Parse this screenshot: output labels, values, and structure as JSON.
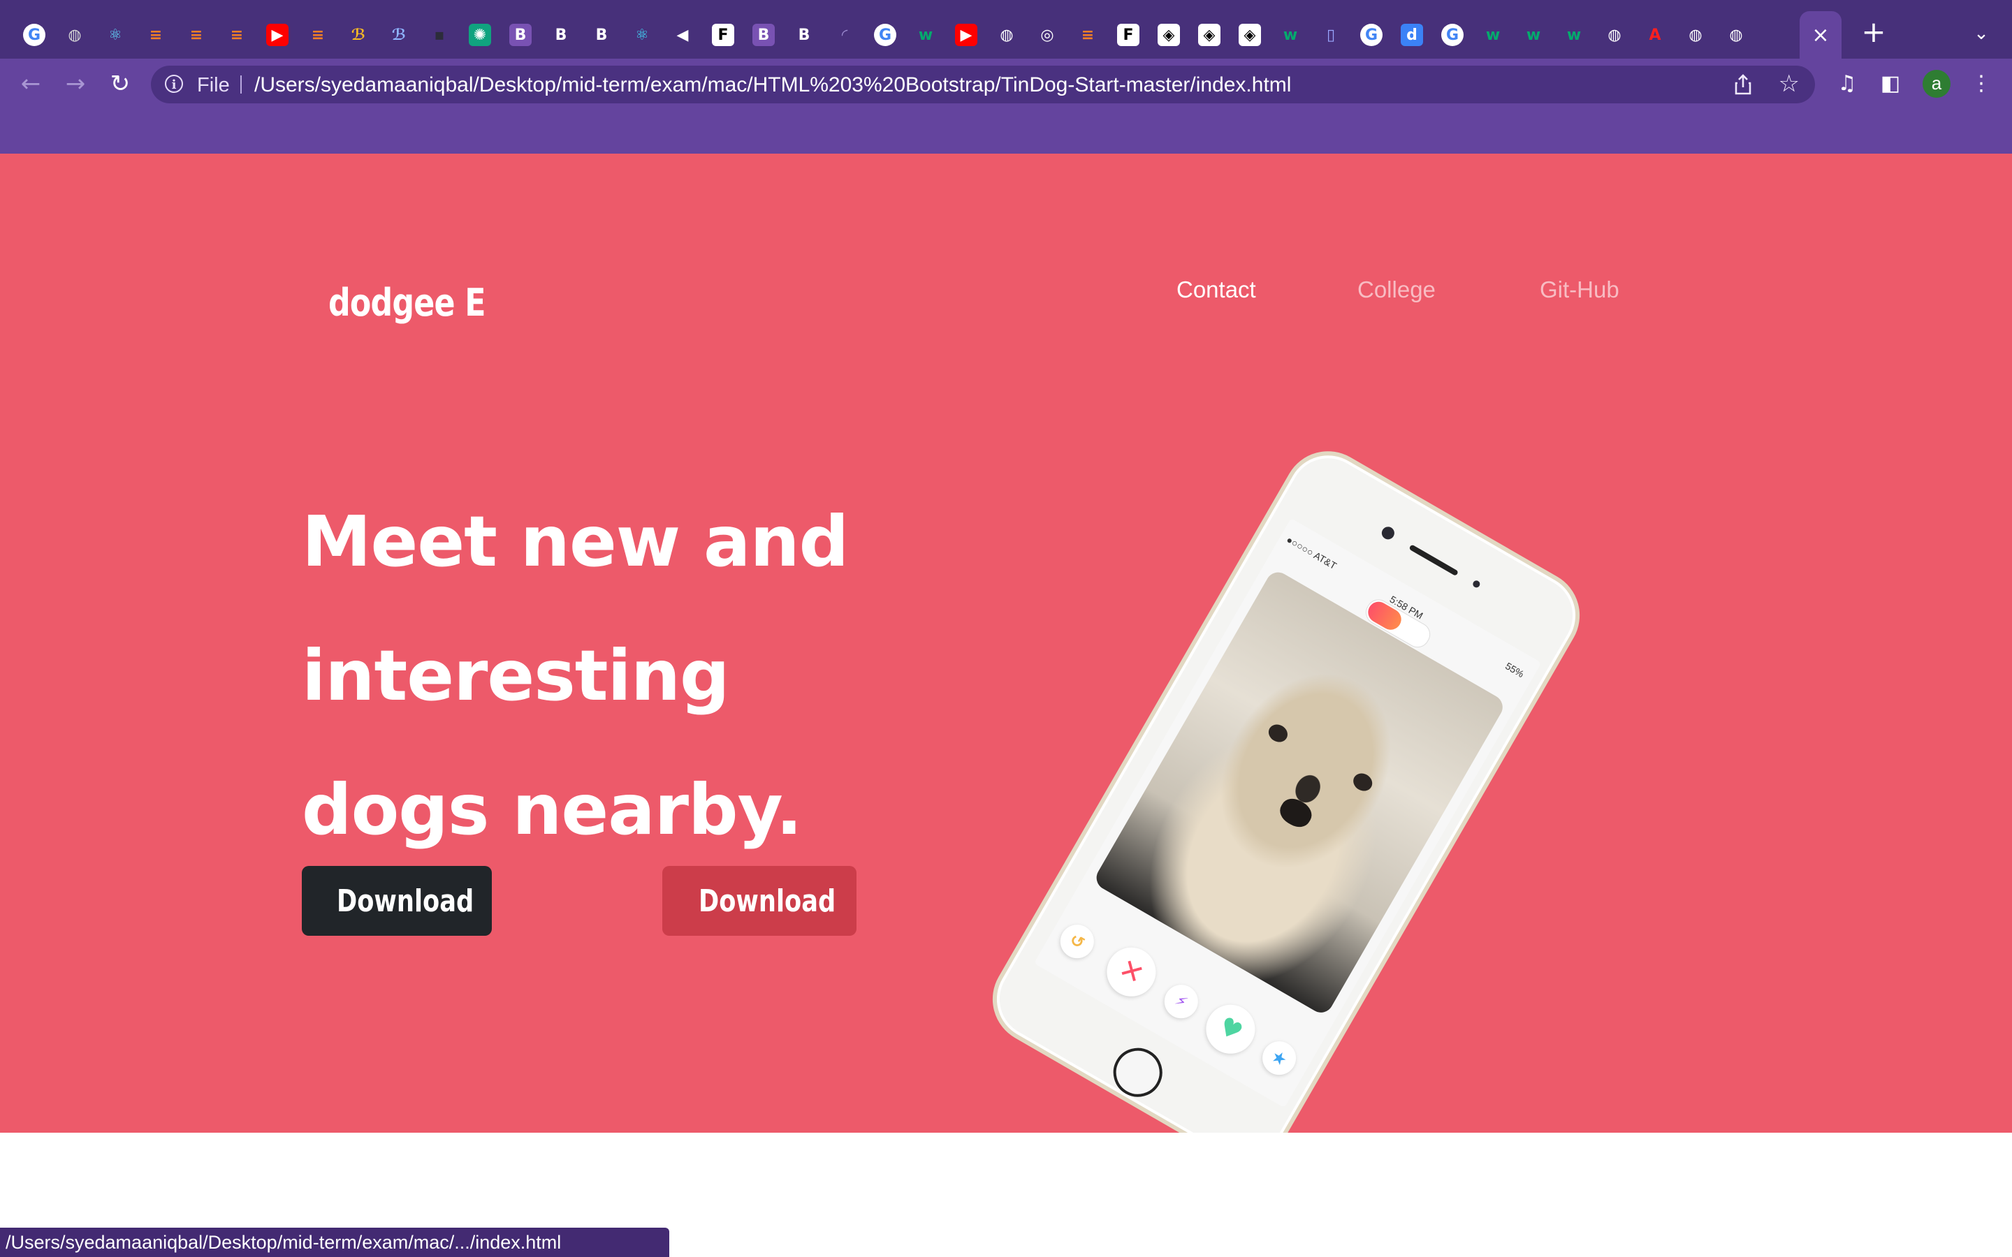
{
  "browser": {
    "tabs": [
      {
        "icon": "google-icon",
        "glyph": "G",
        "bg": "#ffffff",
        "fg": "#4285f4",
        "round": true
      },
      {
        "icon": "globe-icon",
        "glyph": "◍",
        "bg": "transparent",
        "fg": "#d7d7d7",
        "round": true
      },
      {
        "icon": "react-icon",
        "glyph": "⚛",
        "bg": "transparent",
        "fg": "#61dafb",
        "round": true
      },
      {
        "icon": "stackoverflow-icon",
        "glyph": "≡",
        "bg": "transparent",
        "fg": "#f48024",
        "round": false
      },
      {
        "icon": "stackoverflow-icon",
        "glyph": "≡",
        "bg": "transparent",
        "fg": "#f48024",
        "round": false
      },
      {
        "icon": "stackoverflow-icon",
        "glyph": "≡",
        "bg": "transparent",
        "fg": "#f48024",
        "round": false
      },
      {
        "icon": "youtube-icon",
        "glyph": "▶",
        "bg": "#ff0000",
        "fg": "#ffffff",
        "round": false
      },
      {
        "icon": "stackoverflow-icon",
        "glyph": "≡",
        "bg": "transparent",
        "fg": "#f48024",
        "round": false
      },
      {
        "icon": "figma-plugin-icon",
        "glyph": "ℬ",
        "bg": "transparent",
        "fg": "#f7b924",
        "round": false
      },
      {
        "icon": "figma-plugin-icon",
        "glyph": "ℬ",
        "bg": "transparent",
        "fg": "#8fb5ff",
        "round": false
      },
      {
        "icon": "dark-app-icon",
        "glyph": "▪",
        "bg": "transparent",
        "fg": "#2c2c3a",
        "round": false
      },
      {
        "icon": "chatgpt-icon",
        "glyph": "✺",
        "bg": "#10a37f",
        "fg": "#ffffff",
        "round": false
      },
      {
        "icon": "bootstrap-icon",
        "glyph": "B",
        "bg": "#7952b3",
        "fg": "#ffffff",
        "round": false
      },
      {
        "icon": "bootstrap-icon",
        "glyph": "B",
        "bg": "transparent",
        "fg": "#ffffff",
        "round": false
      },
      {
        "icon": "bootstrap-icon",
        "glyph": "B",
        "bg": "transparent",
        "fg": "#ffffff",
        "round": false
      },
      {
        "icon": "react-bootstrap-icon",
        "glyph": "⚛",
        "bg": "transparent",
        "fg": "#41e0fd",
        "round": true
      },
      {
        "icon": "speaker-icon",
        "glyph": "◀",
        "bg": "transparent",
        "fg": "#ffffff",
        "round": false
      },
      {
        "icon": "framer-icon",
        "glyph": "F",
        "bg": "#ffffff",
        "fg": "#000000",
        "round": false
      },
      {
        "icon": "bootstrap-icon",
        "glyph": "B",
        "bg": "#7952b3",
        "fg": "#ffffff",
        "round": false
      },
      {
        "icon": "bootstrap-icon",
        "glyph": "B",
        "bg": "transparent",
        "fg": "#ffffff",
        "round": false
      },
      {
        "icon": "loading-spinner-icon",
        "glyph": "◜",
        "bg": "transparent",
        "fg": "#9c8bd0",
        "round": true
      },
      {
        "icon": "google-icon",
        "glyph": "G",
        "bg": "#ffffff",
        "fg": "#4285f4",
        "round": true
      },
      {
        "icon": "w3schools-icon",
        "glyph": "w",
        "bg": "transparent",
        "fg": "#04aa6d",
        "round": false
      },
      {
        "icon": "youtube-icon",
        "glyph": "▶",
        "bg": "#ff0000",
        "fg": "#ffffff",
        "round": false
      },
      {
        "icon": "globe-icon",
        "glyph": "◍",
        "bg": "transparent",
        "fg": "#ffffff",
        "round": true
      },
      {
        "icon": "chrome-icon",
        "glyph": "◎",
        "bg": "transparent",
        "fg": "#ffffff",
        "round": true
      },
      {
        "icon": "stackoverflow-icon",
        "glyph": "≡",
        "bg": "transparent",
        "fg": "#f48024",
        "round": false
      },
      {
        "icon": "framer-icon",
        "glyph": "F",
        "bg": "#ffffff",
        "fg": "#000000",
        "round": false
      },
      {
        "icon": "codepen-icon",
        "glyph": "◈",
        "bg": "#ffffff",
        "fg": "#000000",
        "round": false
      },
      {
        "icon": "codepen-icon",
        "glyph": "◈",
        "bg": "#ffffff",
        "fg": "#000000",
        "round": false
      },
      {
        "icon": "codepen-icon",
        "glyph": "◈",
        "bg": "#ffffff",
        "fg": "#000000",
        "round": false
      },
      {
        "icon": "w3schools-icon",
        "glyph": "w",
        "bg": "transparent",
        "fg": "#04aa6d",
        "round": false
      },
      {
        "icon": "docs-icon",
        "glyph": "▯",
        "bg": "transparent",
        "fg": "#9aa7ff",
        "round": false
      },
      {
        "icon": "google-icon",
        "glyph": "G",
        "bg": "#ffffff",
        "fg": "#4285f4",
        "round": true
      },
      {
        "icon": "dribbble-icon",
        "glyph": "d",
        "bg": "#3b82f6",
        "fg": "#ffffff",
        "round": false
      },
      {
        "icon": "google-icon",
        "glyph": "G",
        "bg": "#ffffff",
        "fg": "#4285f4",
        "round": true
      },
      {
        "icon": "w3schools-icon",
        "glyph": "w",
        "bg": "transparent",
        "fg": "#04aa6d",
        "round": false
      },
      {
        "icon": "w3schools-icon",
        "glyph": "w",
        "bg": "transparent",
        "fg": "#04aa6d",
        "round": false
      },
      {
        "icon": "w3schools-icon",
        "glyph": "w",
        "bg": "transparent",
        "fg": "#04aa6d",
        "round": false
      },
      {
        "icon": "globe-icon",
        "glyph": "◍",
        "bg": "transparent",
        "fg": "#ffffff",
        "round": true
      },
      {
        "icon": "adobe-icon",
        "glyph": "A",
        "bg": "transparent",
        "fg": "#ff1f1f",
        "round": false
      },
      {
        "icon": "globe-icon",
        "glyph": "◍",
        "bg": "transparent",
        "fg": "#ffffff",
        "round": true
      },
      {
        "icon": "globe-icon",
        "glyph": "◍",
        "bg": "transparent",
        "fg": "#ffffff",
        "round": true
      }
    ],
    "active_tab_close": "×",
    "new_tab": "+",
    "tab_menu": "⌄",
    "back": "←",
    "forward": "→",
    "reload": "↻",
    "scheme_label": "File",
    "url": "/Users/syedamaaniqbal/Desktop/mid-term/exam/mac/HTML%203%20Bootstrap/TinDog-Start-master/index.html",
    "bookmark_star": "☆",
    "media_icon": "♫",
    "sidepanel_icon": "◧",
    "avatar_letter": "a",
    "menu_icon": "⋮",
    "status_url": "/Users/syedamaaniqbal/Desktop/mid-term/exam/mac/.../index.html"
  },
  "page": {
    "brand": "dodgee E",
    "nav": [
      "Contact",
      "College",
      "Git-Hub"
    ],
    "headline": "Meet new and interesting dogs nearby.",
    "buttons": [
      {
        "icon": "apple-icon",
        "label": "Download"
      },
      {
        "icon": "windows-icon",
        "label": "Download"
      }
    ],
    "phone": {
      "carrier": "●○○○○ AT&T",
      "time": "5:58 PM",
      "battery": "55%"
    }
  },
  "colors": {
    "hero_bg": "#ed5a6a",
    "chrome_dark": "#47307a",
    "chrome_light": "#64449e",
    "apple_button": "#212529",
    "windows_button": "#cc3d4a"
  }
}
